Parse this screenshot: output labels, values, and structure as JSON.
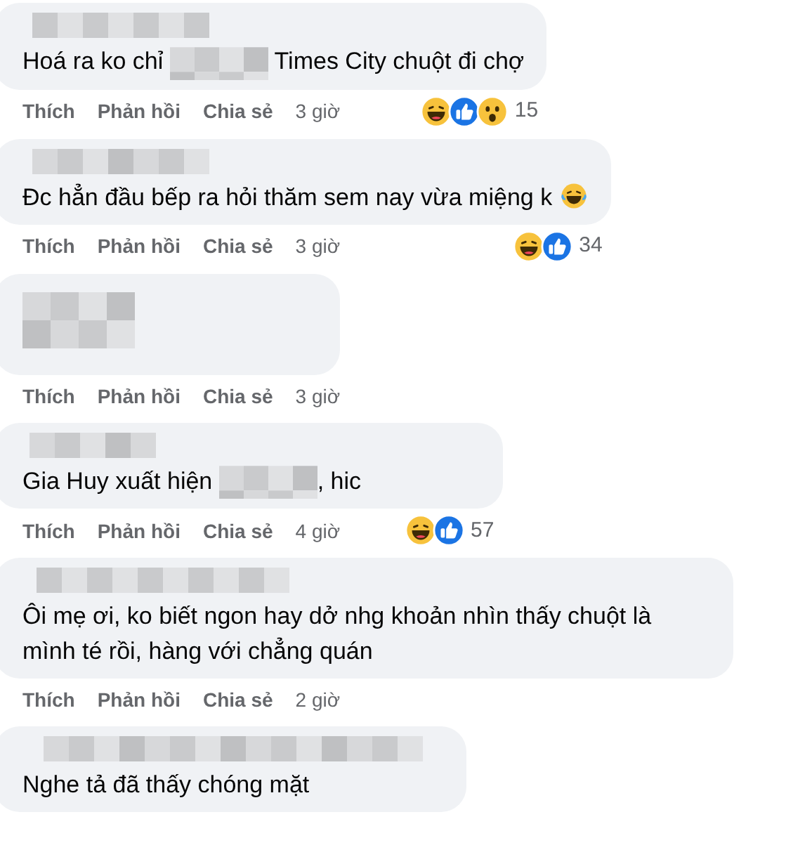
{
  "comments": [
    {
      "segments": [
        {
          "kind": "text",
          "text": "Hoá ra ko chỉ "
        },
        {
          "kind": "redacted"
        },
        {
          "kind": "text",
          "text": " Times City chuột đi chợ"
        }
      ],
      "actions": [
        "Thích",
        "Phản hồi",
        "Chia sẻ"
      ],
      "time": "3 giờ",
      "reactions": [
        {
          "kind": "haha"
        },
        {
          "kind": "like"
        },
        {
          "kind": "wow"
        }
      ],
      "reaction_count": "15"
    },
    {
      "segments": [
        {
          "kind": "text",
          "text": "Đc hẳn đầu bếp ra hỏi thăm sem nay vừa miệng k "
        },
        {
          "kind": "emoji"
        }
      ],
      "actions": [
        "Thích",
        "Phản hồi",
        "Chia sẻ"
      ],
      "time": "3 giờ",
      "reactions": [
        {
          "kind": "haha"
        },
        {
          "kind": "like"
        }
      ],
      "reaction_count": "34"
    },
    {
      "actions": [
        "Thích",
        "Phản hồi",
        "Chia sẻ"
      ],
      "time": "3 giờ"
    },
    {
      "segments": [
        {
          "kind": "text",
          "text": "Gia Huy xuất hiện "
        },
        {
          "kind": "redacted"
        },
        {
          "kind": "text",
          "text": ", hic"
        }
      ],
      "actions": [
        "Thích",
        "Phản hồi",
        "Chia sẻ"
      ],
      "time": "4 giờ",
      "reactions": [
        {
          "kind": "haha"
        },
        {
          "kind": "like"
        }
      ],
      "reaction_count": "57"
    },
    {
      "segments": [
        {
          "kind": "text",
          "text": "Ôi mẹ ơi, ko biết ngon hay dở nhg khoản nhìn thấy chuột là mình té rồi, hàng với chẳng quán"
        }
      ],
      "actions": [
        "Thích",
        "Phản hồi",
        "Chia sẻ"
      ],
      "time": "2 giờ"
    },
    {
      "segments": [
        {
          "kind": "text",
          "text": "Nghe tả đã thấy chóng mặt"
        }
      ]
    }
  ]
}
